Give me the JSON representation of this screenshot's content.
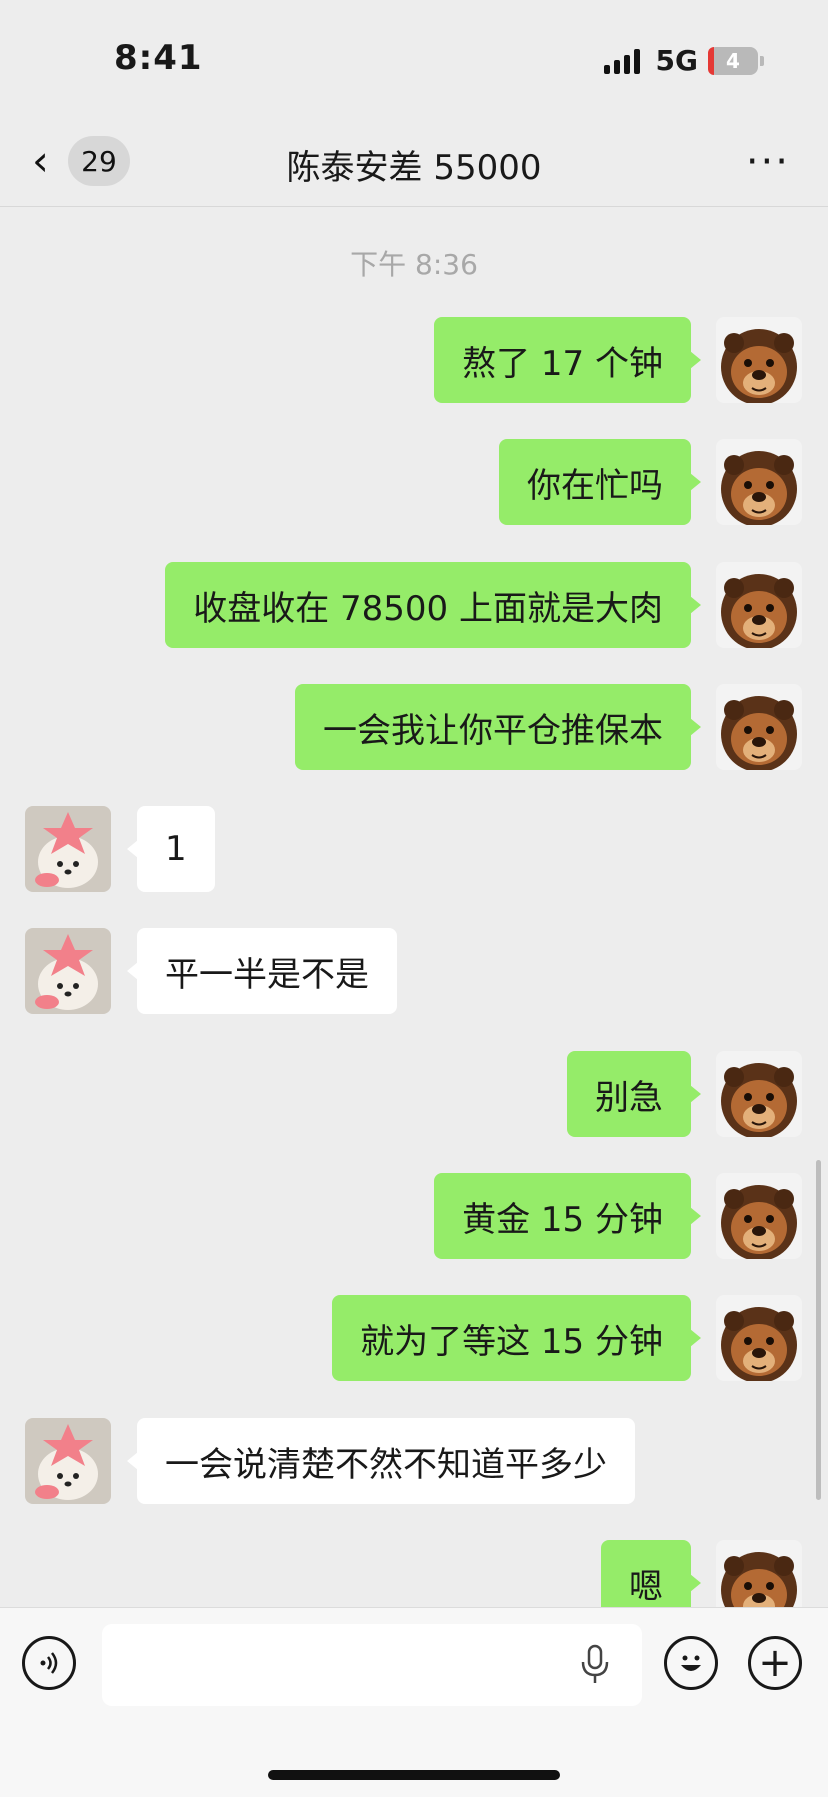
{
  "status_bar": {
    "time": "8:41",
    "network": "5G",
    "battery": "4"
  },
  "header": {
    "unread_count": "29",
    "title": "陈泰安差 55000",
    "more_icon": "more-dots-icon"
  },
  "chat": {
    "timestamp": "下午 8:36",
    "messages": [
      {
        "from": "me",
        "text": "熬了 17 个钟"
      },
      {
        "from": "me",
        "text": "你在忙吗"
      },
      {
        "from": "me",
        "text": "收盘收在 78500 上面就是大肉"
      },
      {
        "from": "me",
        "text": "一会我让你平仓推保本"
      },
      {
        "from": "other",
        "text": "1"
      },
      {
        "from": "other",
        "text": "平一半是不是"
      },
      {
        "from": "me",
        "text": "别急"
      },
      {
        "from": "me",
        "text": "黄金 15 分钟"
      },
      {
        "from": "me",
        "text": "就为了等这 15 分钟"
      },
      {
        "from": "other",
        "text": "一会说清楚不然不知道平多少"
      },
      {
        "from": "me",
        "text": "嗯"
      }
    ]
  },
  "input_bar": {
    "value": "",
    "icons": [
      "voice-icon",
      "mic-icon",
      "emoji-icon",
      "plus-icon"
    ]
  },
  "colors": {
    "my_bubble": "#95ec69",
    "their_bubble": "#ffffff",
    "background": "#ededed"
  }
}
